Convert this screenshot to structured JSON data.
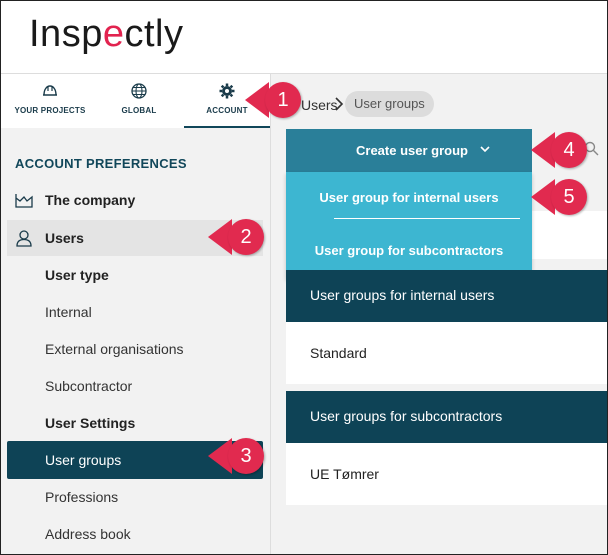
{
  "app": {
    "logo_text": "Inspectly"
  },
  "tabs": [
    {
      "label": "YOUR PROJECTS",
      "icon": "helmet-icon"
    },
    {
      "label": "GLOBAL",
      "icon": "globe-icon"
    },
    {
      "label": "ACCOUNT",
      "icon": "gear-icon",
      "active": true
    }
  ],
  "sidebar": {
    "section_title": "ACCOUNT PREFERENCES",
    "company": "The company",
    "users": "Users",
    "sub_items": [
      {
        "label": "User type",
        "bold": true
      },
      {
        "label": "Internal"
      },
      {
        "label": "External organisations"
      },
      {
        "label": "Subcontractor"
      },
      {
        "label": "User Settings",
        "bold": true
      },
      {
        "label": "User groups",
        "active": true
      },
      {
        "label": "Professions"
      },
      {
        "label": "Address book"
      }
    ]
  },
  "breadcrumb": {
    "parent": "Users",
    "current": "User groups"
  },
  "create_button": {
    "label": "Create user group"
  },
  "dropdown": {
    "items": [
      "User group for internal users",
      "User group for subcontractors"
    ]
  },
  "sections": [
    {
      "title": "User groups for internal users",
      "rows": [
        "Standard"
      ]
    },
    {
      "title": "User groups for subcontractors",
      "rows": [
        "UE Tømrer"
      ]
    }
  ],
  "callouts": [
    "1",
    "2",
    "3",
    "4",
    "5"
  ],
  "colors": {
    "accent": "#0e4356",
    "button": "#2a7f99",
    "dropdown": "#3db6d1",
    "callout": "#e12a4f"
  }
}
